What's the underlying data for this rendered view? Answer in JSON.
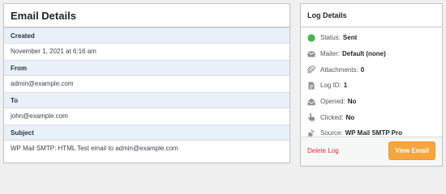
{
  "email_details": {
    "title": "Email Details",
    "fields": [
      {
        "label": "Created",
        "value": "November 1, 2021 at 6:16 am"
      },
      {
        "label": "From",
        "value": "admin@example.com"
      },
      {
        "label": "To",
        "value": "john@example.com"
      },
      {
        "label": "Subject",
        "value": "WP Mail SMTP: HTML Test email to admin@example.com"
      }
    ]
  },
  "log_details": {
    "title": "Log Details",
    "rows": [
      {
        "icon": "status-dot-icon",
        "label": "Status:",
        "value": "Sent",
        "color": "#46b450"
      },
      {
        "icon": "mail-icon",
        "label": "Mailer:",
        "value": "Default (none)"
      },
      {
        "icon": "paperclip-icon",
        "label": "Attachments:",
        "value": "0"
      },
      {
        "icon": "document-icon",
        "label": "Log ID:",
        "value": "1"
      },
      {
        "icon": "open-envelope-icon",
        "label": "Opened:",
        "value": "No"
      },
      {
        "icon": "pointer-hand-icon",
        "label": "Clicked:",
        "value": "No"
      },
      {
        "icon": "plug-icon",
        "label": "Source:",
        "value": "WP Mail SMTP Pro"
      }
    ],
    "delete_label": "Delete Log",
    "view_button_label": "View Email"
  },
  "colors": {
    "accent_orange": "#f6a63a",
    "delete_red": "#d63638",
    "field_label_bg": "#e8f0fa",
    "status_green": "#46b450"
  }
}
